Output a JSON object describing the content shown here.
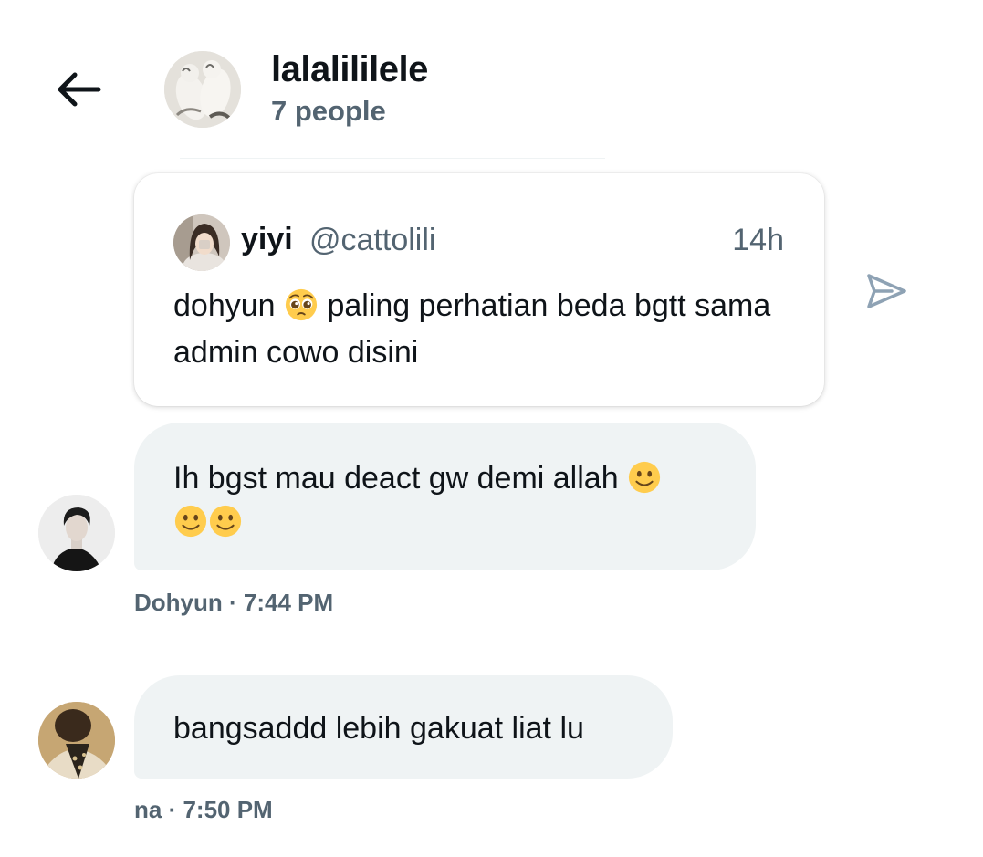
{
  "header": {
    "group_name": "lalalililele",
    "member_count": "7 people"
  },
  "quote": {
    "author_name": "yiyi",
    "author_handle": "@cattolili",
    "time_ago": "14h",
    "text_before_emoji": "dohyun ",
    "emoji": "pleading-face-emoji",
    "text_after_emoji": " paling perhatian beda bgtt sama admin cowo disini"
  },
  "messages": [
    {
      "text": "Ih bgst mau deact gw demi allah ",
      "emoji": "slightly-smiling-face-emoji",
      "emoji_count": 3,
      "sender": "Dohyun",
      "time": "7:44 PM",
      "meta": "Dohyun · 7:44 PM"
    },
    {
      "text": "bangsaddd lebih gakuat liat lu",
      "sender": "na",
      "time": "7:50 PM",
      "meta": "na · 7:50 PM"
    }
  ],
  "colors": {
    "text_primary": "#0f1419",
    "text_secondary": "#536471",
    "bubble_background": "#eff3f4",
    "share_icon": "#8ea2b4"
  }
}
